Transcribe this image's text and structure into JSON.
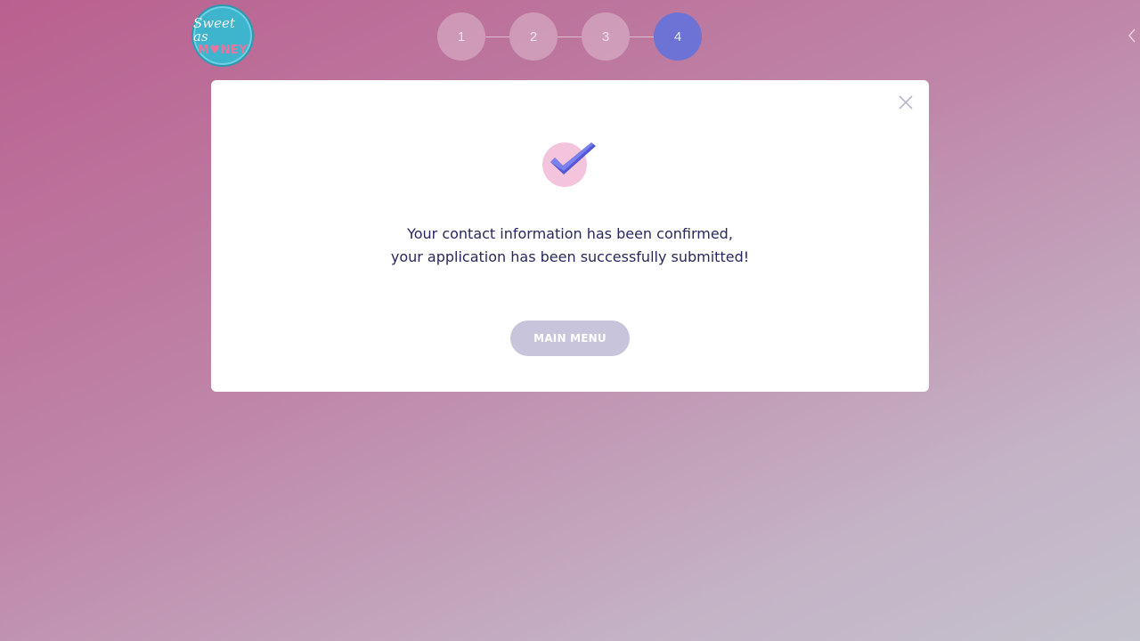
{
  "logo": {
    "top": "Sweet as",
    "bottom_pre": "M",
    "bottom_dot": "♥",
    "bottom_post": "NEY"
  },
  "steps": [
    {
      "label": "1",
      "active": false
    },
    {
      "label": "2",
      "active": false
    },
    {
      "label": "3",
      "active": false
    },
    {
      "label": "4",
      "active": true
    }
  ],
  "modal": {
    "message_line1": "Your contact information has been confirmed,",
    "message_line2": "your application has been successfully submitted!",
    "button_label": "MAIN MENU"
  },
  "icons": {
    "close": "close-icon",
    "check": "check-icon",
    "back": "chevron-left-icon"
  },
  "colors": {
    "accent": "#6c73d4",
    "text": "#29285c",
    "button": "#c7c4dc",
    "logo": "#3fb4cd",
    "check_bg": "#f4c4dc"
  }
}
